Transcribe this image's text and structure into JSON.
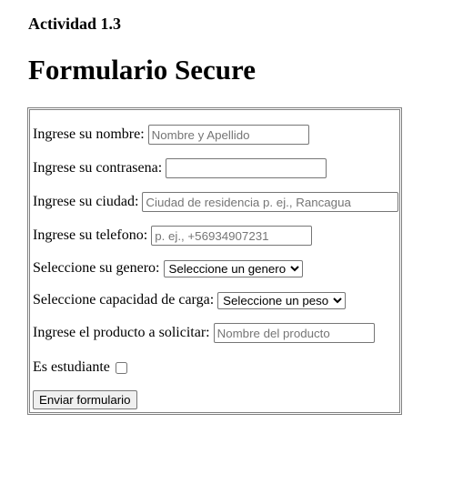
{
  "header": {
    "subtitle": "Actividad 1.3",
    "title": "Formulario Secure"
  },
  "form": {
    "nombre": {
      "label": "Ingrese su nombre:",
      "placeholder": "Nombre y Apellido",
      "value": ""
    },
    "contrasena": {
      "label": "Ingrese su contrasena:",
      "value": ""
    },
    "ciudad": {
      "label": "Ingrese su ciudad:",
      "placeholder": "Ciudad de residencia p. ej., Rancagua",
      "value": ""
    },
    "telefono": {
      "label": "Ingrese su telefono:",
      "placeholder": "p. ej., +56934907231",
      "value": ""
    },
    "genero": {
      "label": "Seleccione su genero:",
      "selected": "Seleccione un genero"
    },
    "carga": {
      "label": "Seleccione capacidad de carga:",
      "selected": "Seleccione un peso"
    },
    "producto": {
      "label": "Ingrese el producto a solicitar:",
      "placeholder": "Nombre del producto",
      "value": ""
    },
    "estudiante": {
      "label": "Es estudiante",
      "checked": false
    },
    "submit_label": "Enviar formulario"
  }
}
